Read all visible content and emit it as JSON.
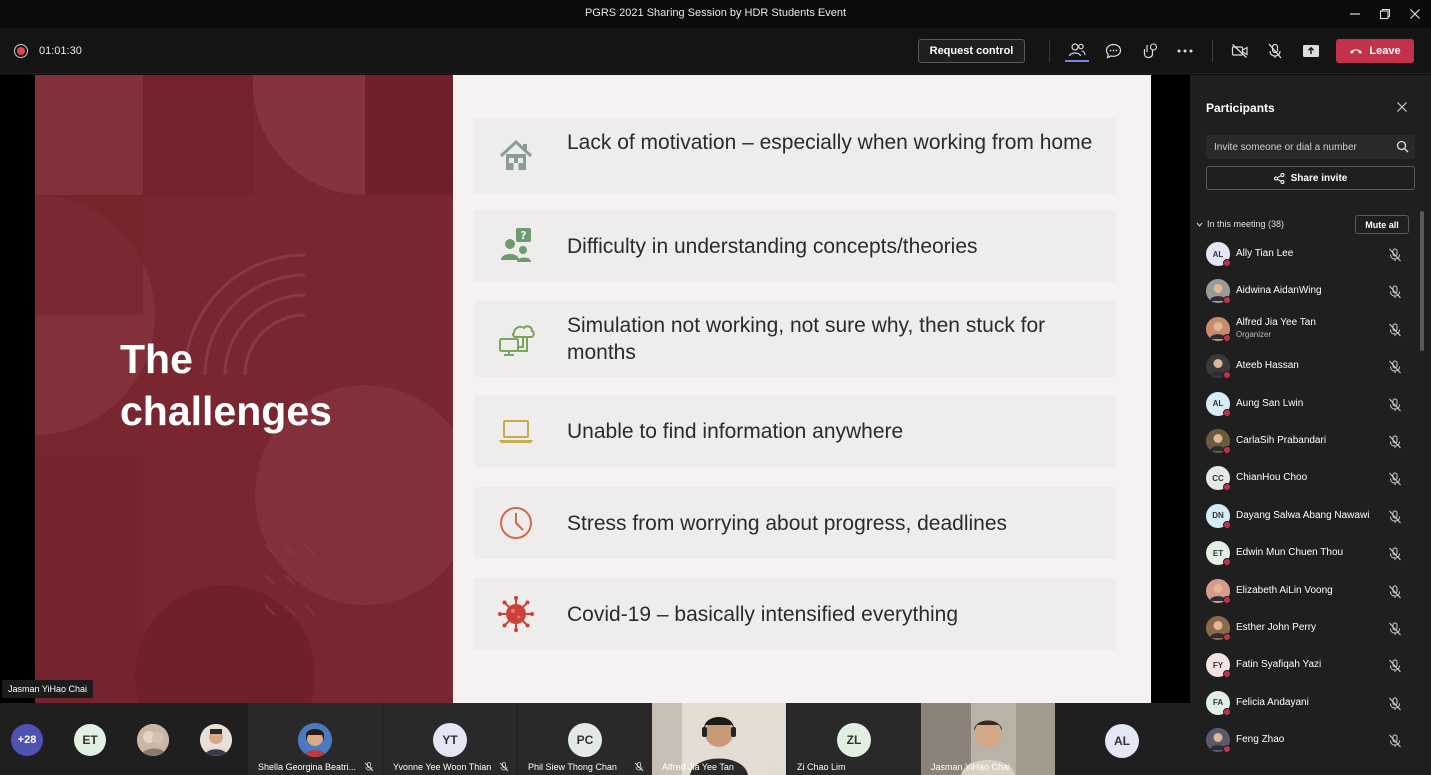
{
  "window": {
    "title": "PGRS 2021 Sharing Session by HDR Students Event",
    "minimize_icon": "minimize-icon",
    "restore_icon": "restore-icon",
    "close_icon": "close-icon"
  },
  "toolbar": {
    "timer": "01:01:30",
    "request_control_label": "Request control",
    "leave_label": "Leave"
  },
  "slide": {
    "title_line1": "The",
    "title_line2": "challenges",
    "items": [
      {
        "text": "Lack of motivation – especially when working from home",
        "icon": "house-icon",
        "color": "#8c9a98"
      },
      {
        "text": "Difficulty in understanding concepts/theories",
        "icon": "question-people-icon",
        "color": "#6f9a6f"
      },
      {
        "text": "Simulation not working, not sure why, then stuck for months",
        "icon": "cloud-computer-icon",
        "color": "#7aa35e"
      },
      {
        "text": "Unable to find information anywhere",
        "icon": "laptop-icon",
        "color": "#c4ab4e"
      },
      {
        "text": "Stress from worrying about progress, deadlines",
        "icon": "clock-icon",
        "color": "#d2694f"
      },
      {
        "text": "Covid-19 – basically intensified everything",
        "icon": "virus-icon",
        "color": "#cc4136"
      }
    ]
  },
  "presenter_tag": "Jasman YiHao Chai",
  "strip": {
    "overflow": "+28",
    "small": [
      {
        "initials": "ET"
      }
    ],
    "tiles": [
      {
        "name": "Shella Georgina Beatri...",
        "initials": ""
      },
      {
        "name": "Yvonne Yee Woon Thian",
        "initials": "YT"
      },
      {
        "name": "Phil Siew Thong Chan",
        "initials": "PC"
      },
      {
        "name": "Alfred Jia Yee Tan",
        "initials": ""
      },
      {
        "name": "Zi Chao Lim",
        "initials": "ZL"
      },
      {
        "name": "Jasman YiHao Chai",
        "initials": ""
      },
      {
        "name": "",
        "initials": "AL"
      }
    ]
  },
  "panel": {
    "title": "Participants",
    "invite_placeholder": "Invite someone or dial a number",
    "share_invite_label": "Share invite",
    "in_meeting_label": "In this meeting (38)",
    "mute_all_label": "Mute all",
    "participants": [
      {
        "name": "Ally Tian Lee",
        "initials": "AL",
        "color": "#e3e6f5",
        "role": ""
      },
      {
        "name": "Aidwina AidanWing",
        "initials": "",
        "color": "#9a9a9a",
        "role": ""
      },
      {
        "name": "Alfred Jia Yee Tan",
        "initials": "",
        "color": "#c98b6b",
        "role": "Organizer"
      },
      {
        "name": "Ateeb Hassan",
        "initials": "",
        "color": "#3a3a3a",
        "role": ""
      },
      {
        "name": "Aung San Lwin",
        "initials": "AL",
        "color": "#d7ecf5",
        "role": ""
      },
      {
        "name": "CarlaSih Prabandari",
        "initials": "",
        "color": "#6b5a3e",
        "role": ""
      },
      {
        "name": "ChianHou Choo",
        "initials": "CC",
        "color": "#e3e9e6",
        "role": ""
      },
      {
        "name": "Dayang Salwa Abang Nawawi",
        "initials": "DN",
        "color": "#d4ecf3",
        "role": ""
      },
      {
        "name": "Edwin Mun Chuen Thou",
        "initials": "ET",
        "color": "#e2efe3",
        "role": ""
      },
      {
        "name": "Elizabeth AiLin Voong",
        "initials": "",
        "color": "#d89a8a",
        "role": ""
      },
      {
        "name": "Esther John Perry",
        "initials": "",
        "color": "#8a6a4a",
        "role": ""
      },
      {
        "name": "Fatin Syafiqah Yazi",
        "initials": "FY",
        "color": "#f6e2e3",
        "role": ""
      },
      {
        "name": "Felicia Andayani",
        "initials": "FA",
        "color": "#e2efe3",
        "role": ""
      },
      {
        "name": "Feng Zhao",
        "initials": "",
        "color": "#5a5a6a",
        "role": ""
      }
    ]
  },
  "colors": {
    "leave": "#c4314b",
    "slide_red": "#7a2630",
    "accent": "#7b83eb"
  }
}
